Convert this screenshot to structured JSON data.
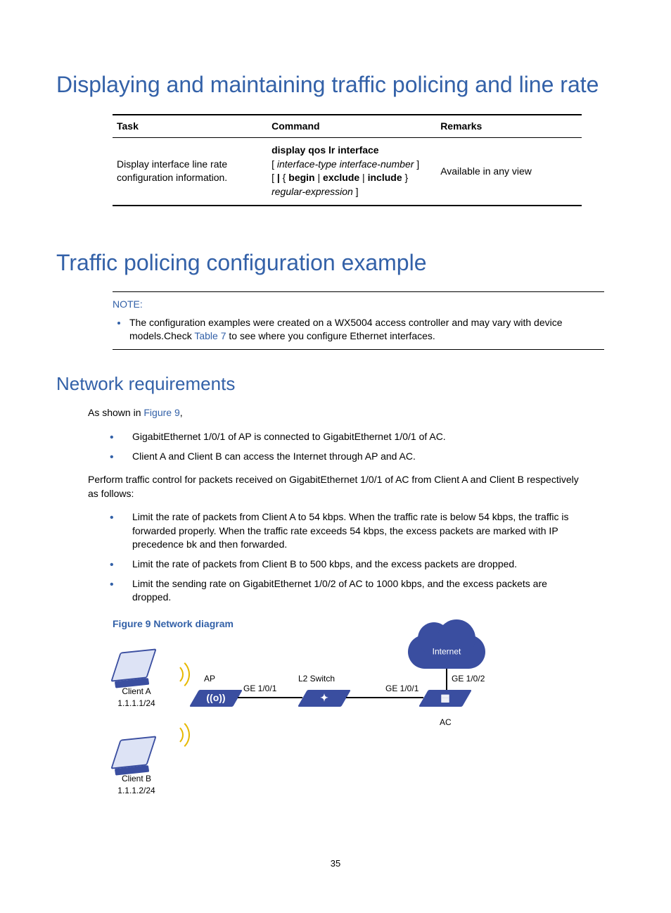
{
  "h1a": "Displaying and maintaining traffic policing and line rate",
  "table": {
    "headers": [
      "Task",
      "Command",
      "Remarks"
    ],
    "row": {
      "task": "Display interface line rate configuration information.",
      "cmd_line1_strong": "display qos lr interface",
      "cmd_line2_em": "interface-type interface-number",
      "cmd_line3_a": "begin",
      "cmd_line3_b": "exclude",
      "cmd_line3_c": "include",
      "cmd_line4_em": "regular-expression",
      "remarks": "Available in any view"
    }
  },
  "h1b": "Traffic policing configuration example",
  "note": {
    "label": "NOTE:",
    "text_a": "The configuration examples were created on a WX5004 access controller and may vary with device models.Check ",
    "link": "Table 7",
    "text_b": " to see where you configure Ethernet interfaces."
  },
  "h2": "Network requirements",
  "intro_a": "As shown in ",
  "intro_link": "Figure 9",
  "intro_b": ",",
  "bullets_a": [
    "GigabitEthernet 1/0/1 of AP is connected to GigabitEthernet 1/0/1 of AC.",
    "Client A and Client B can access the Internet through AP and AC."
  ],
  "para": "Perform traffic control for packets received on GigabitEthernet 1/0/1 of AC from Client A and Client B respectively as follows:",
  "bullets_b": [
    "Limit the rate of packets from Client A to 54 kbps. When the traffic rate is below 54 kbps, the traffic is forwarded properly. When the traffic rate exceeds 54 kbps, the excess packets are marked with IP precedence bk and then forwarded.",
    "Limit the rate of packets from Client B to 500 kbps, and the excess packets are dropped.",
    "Limit the sending rate on GigabitEthernet 1/0/2 of AC to 1000 kbps, and the excess packets are dropped."
  ],
  "figure_caption": "Figure 9 Network diagram",
  "diagram": {
    "client_a": "Client A",
    "client_a_ip": "1.1.1.1/24",
    "client_b": "Client B",
    "client_b_ip": "1.1.1.2/24",
    "ap": "AP",
    "ge101_a": "GE 1/0/1",
    "l2": "L2 Switch",
    "ge101_b": "GE 1/0/1",
    "ac": "AC",
    "ge102": "GE 1/0/2",
    "internet": "Internet"
  },
  "page_num": "35"
}
